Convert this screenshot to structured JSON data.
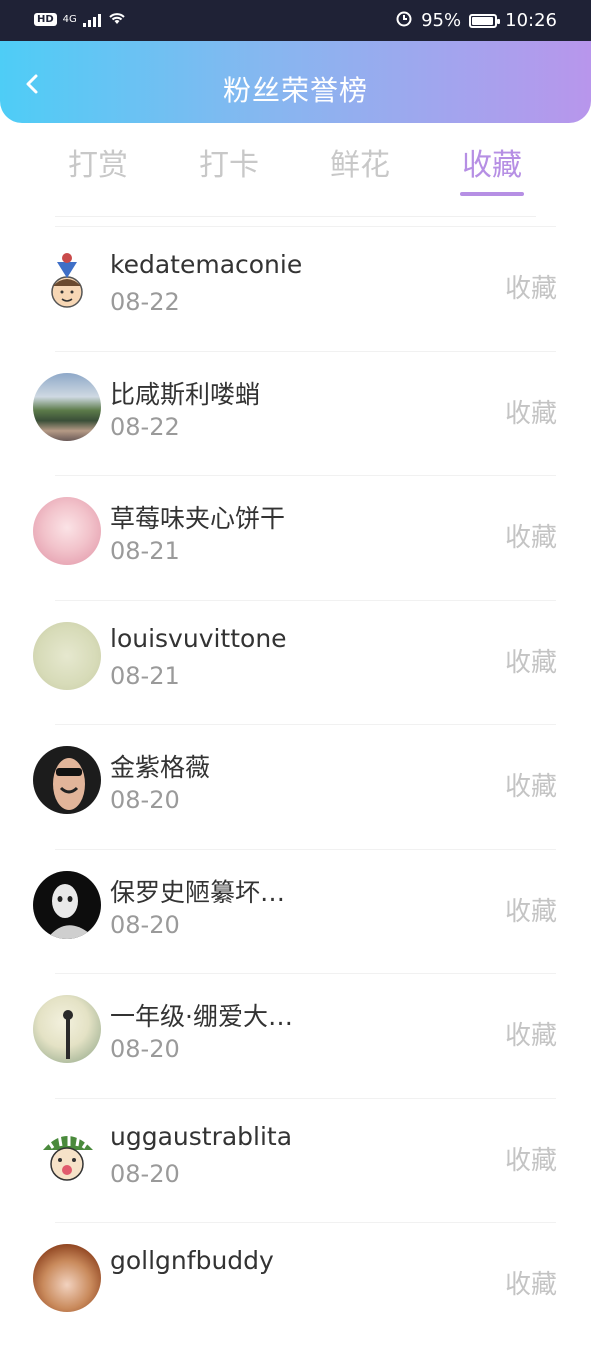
{
  "status": {
    "hd": "HD",
    "net": "4G",
    "battery": "95%",
    "battery_level": 0.95,
    "time": "10:26"
  },
  "header": {
    "title": "粉丝荣誉榜"
  },
  "tabs": [
    {
      "label": "打赏",
      "active": false
    },
    {
      "label": "打卡",
      "active": false
    },
    {
      "label": "鲜花",
      "active": false
    },
    {
      "label": "收藏",
      "active": true
    }
  ],
  "list": [
    {
      "name": "kedatemaconie",
      "date": "08-22",
      "action": "收藏"
    },
    {
      "name": "比咸斯利喽蛸",
      "date": "08-22",
      "action": "收藏"
    },
    {
      "name": "草莓味夹心饼干",
      "date": "08-21",
      "action": "收藏"
    },
    {
      "name": "louisvuvittone",
      "date": "08-21",
      "action": "收藏"
    },
    {
      "name": "金紫格薇",
      "date": "08-20",
      "action": "收藏"
    },
    {
      "name": "保罗史陋纂坏…",
      "date": "08-20",
      "action": "收藏"
    },
    {
      "name": "一年级·绷爱大…",
      "date": "08-20",
      "action": "收藏"
    },
    {
      "name": "uggaustrablita",
      "date": "08-20",
      "action": "收藏"
    },
    {
      "name": "gollgnfbuddy",
      "date": "",
      "action": "收藏"
    }
  ]
}
